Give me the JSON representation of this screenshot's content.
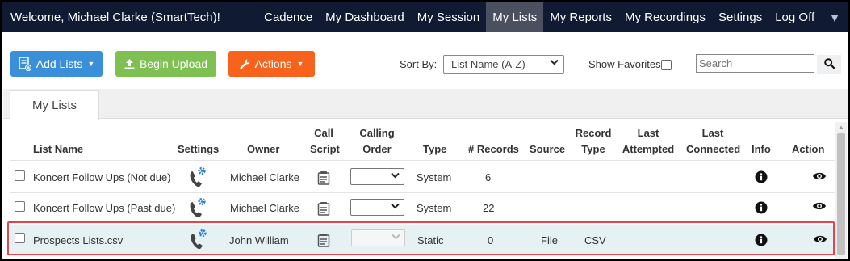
{
  "header": {
    "welcome": "Welcome, Michael Clarke (SmartTech)!",
    "nav": [
      {
        "label": "Cadence",
        "active": false
      },
      {
        "label": "My Dashboard",
        "active": false
      },
      {
        "label": "My Session",
        "active": false
      },
      {
        "label": "My Lists",
        "active": true
      },
      {
        "label": "My Reports",
        "active": false
      },
      {
        "label": "My Recordings",
        "active": false
      },
      {
        "label": "Settings",
        "active": false
      },
      {
        "label": "Log Off",
        "active": false
      }
    ],
    "menu_caret": "▼"
  },
  "toolbar": {
    "add_lists": "Add Lists",
    "begin_upload": "Begin Upload",
    "actions": "Actions",
    "sort_by_label": "Sort By:",
    "sort_by_value": "List Name (A-Z)",
    "show_favorites_label": "Show Favorites",
    "search_placeholder": "Search"
  },
  "tabs": [
    {
      "label": "My Lists"
    }
  ],
  "table": {
    "headers": {
      "list_name": "List Name",
      "settings": "Settings",
      "owner": "Owner",
      "call_script_1": "Call",
      "call_script_2": "Script",
      "calling_order_1": "Calling",
      "calling_order_2": "Order",
      "type": "Type",
      "records": "# Records",
      "source": "Source",
      "record_type_1": "Record",
      "record_type_2": "Type",
      "last_attempted_1": "Last",
      "last_attempted_2": "Attempted",
      "last_connected_1": "Last",
      "last_connected_2": "Connected",
      "info": "Info",
      "action": "Action"
    },
    "rows": [
      {
        "name": "Koncert Follow Ups (Not due)",
        "owner": "Michael Clarke",
        "type": "System",
        "records": "6",
        "source": "",
        "record_type": "",
        "highlighted": false
      },
      {
        "name": "Koncert Follow Ups (Past due)",
        "owner": "Michael Clarke",
        "type": "System",
        "records": "22",
        "source": "",
        "record_type": "",
        "highlighted": false
      },
      {
        "name": "Prospects Lists.csv",
        "owner": "John William",
        "type": "Static",
        "records": "0",
        "source": "File",
        "record_type": "CSV",
        "highlighted": true
      }
    ]
  },
  "colors": {
    "navbar": "#101a33",
    "nav_active": "#4a5060",
    "add_lists_btn": "#3a8fd9",
    "upload_btn": "#7ec052",
    "actions_btn": "#f7631d",
    "highlight_border": "#e8424f",
    "highlight_row": "#e5f1f3",
    "settings_icon_blue": "#2f7fd6"
  },
  "icons": {
    "add_lists": "list-add-icon",
    "begin_upload": "upload-icon",
    "actions": "wrench-icon",
    "search": "search-icon",
    "settings": "phone-gear-icon",
    "call_script": "script-document-icon",
    "info": "info-icon",
    "action": "eye-icon"
  }
}
